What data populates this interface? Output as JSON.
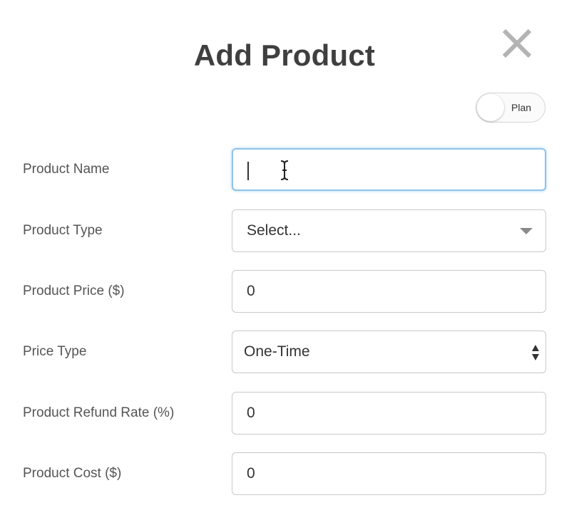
{
  "modal": {
    "title": "Add Product",
    "close_icon": "close-icon"
  },
  "toggle": {
    "label": "Plan",
    "state": "off"
  },
  "form": {
    "fields": [
      {
        "label": "Product Name",
        "value": "",
        "type": "text",
        "focused": true
      },
      {
        "label": "Product Type",
        "value": "Select...",
        "type": "dropdown"
      },
      {
        "label": "Product Price ($)",
        "value": "0",
        "type": "number"
      },
      {
        "label": "Price Type",
        "value": "One-Time",
        "type": "select"
      },
      {
        "label": "Product Refund Rate (%)",
        "value": "0",
        "type": "number"
      },
      {
        "label": "Product Cost ($)",
        "value": "0",
        "type": "number"
      }
    ]
  },
  "colors": {
    "title": "#3f3f3f",
    "label": "#555555",
    "border": "#c9c9c9",
    "focus_border": "#8fc3ea",
    "close_icon": "#b3b3b3"
  }
}
